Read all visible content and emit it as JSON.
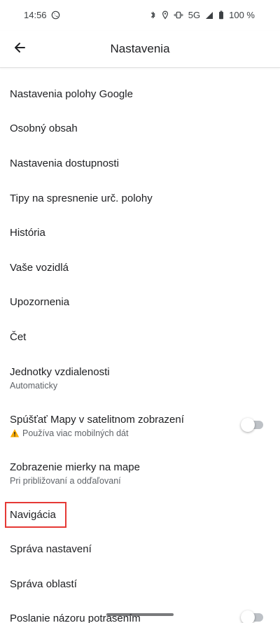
{
  "status_bar": {
    "time": "14:56",
    "network": "5G",
    "battery": "100 %",
    "icons": [
      "viber-icon",
      "bluetooth-icon",
      "location-icon",
      "vibrate-icon",
      "signal-icon",
      "battery-icon"
    ]
  },
  "app_bar": {
    "title": "Nastavenia",
    "back_icon": "arrow-back-icon"
  },
  "items": [
    {
      "label": "Nastavenia polohy Google"
    },
    {
      "label": "Osobný obsah"
    },
    {
      "label": "Nastavenia dostupnosti"
    },
    {
      "label": "Tipy na spresnenie urč. polohy"
    },
    {
      "label": "História"
    },
    {
      "label": "Vaše vozidlá"
    },
    {
      "label": "Upozornenia"
    },
    {
      "label": "Čet"
    },
    {
      "label": "Jednotky vzdialenosti",
      "sub": "Automaticky"
    },
    {
      "label": "Spúšťať Mapy v satelitnom zobrazení",
      "sub": "Používa viac mobilných dát",
      "toggle": false
    },
    {
      "label": "Zobrazenie mierky na mape",
      "sub": "Pri približovaní a odďaľovaní"
    },
    {
      "label": "Navigácia",
      "highlighted": true
    },
    {
      "label": "Správa nastavení"
    },
    {
      "label": "Správa oblastí"
    },
    {
      "label": "Poslanie názoru potrasením",
      "toggle": false
    }
  ],
  "colors": {
    "highlight": "#e53935",
    "text_primary": "#202124",
    "text_secondary": "#5f6368",
    "toggle_off": "#bdc1c6"
  }
}
